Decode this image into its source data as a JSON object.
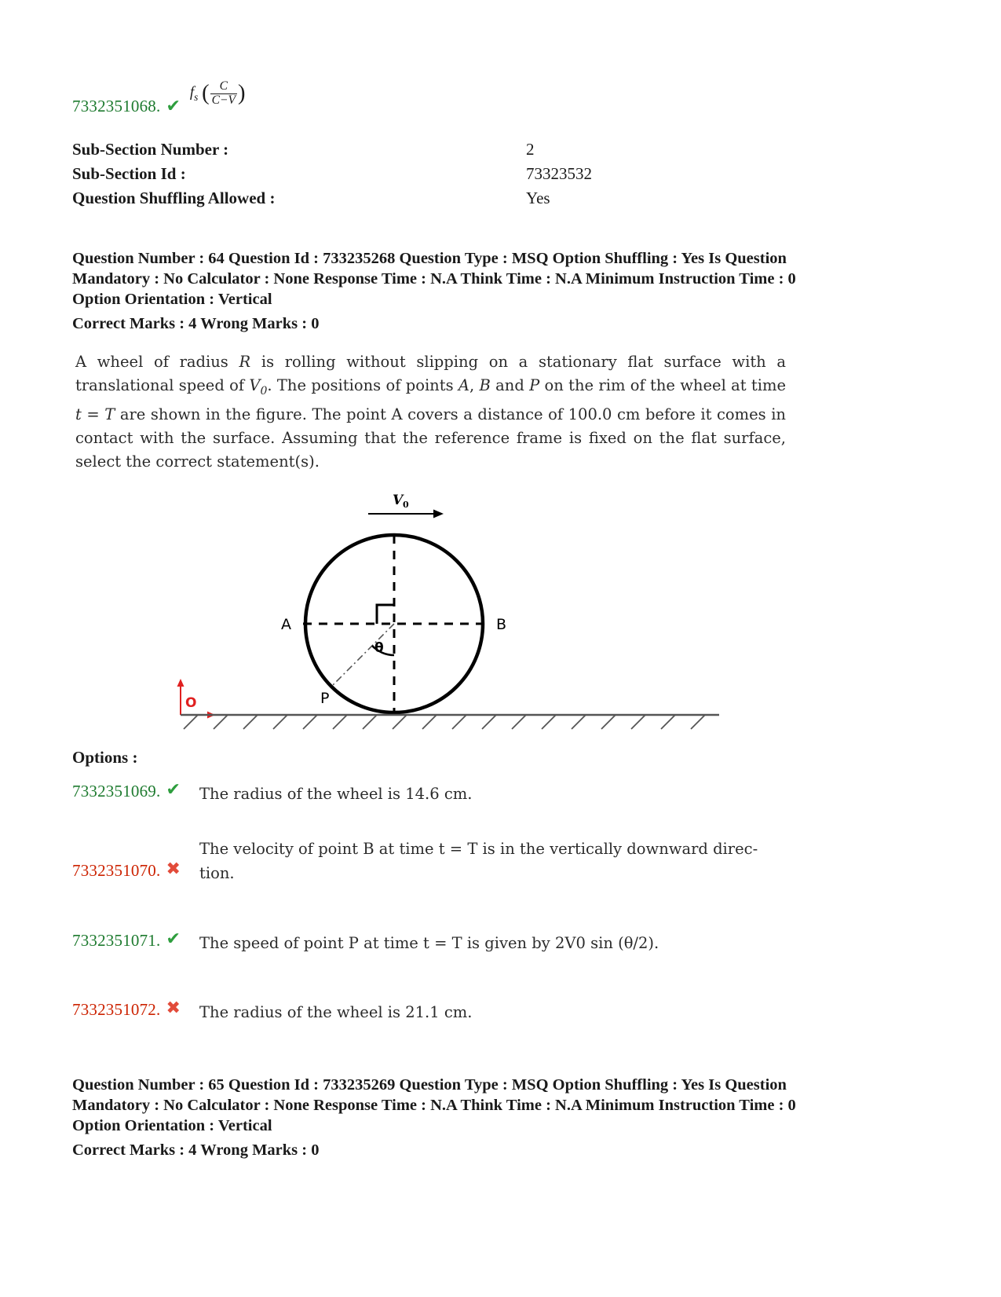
{
  "top_answer": {
    "option_id": "7332351068.",
    "status": "correct",
    "mark_glyph": "✔",
    "formula_fs": "f",
    "formula_sub": "s",
    "formula_num": "C",
    "formula_den": "C−V"
  },
  "meta": {
    "rows": [
      {
        "label": "Sub-Section Number :",
        "value": "2"
      },
      {
        "label": "Sub-Section Id :",
        "value": "73323532"
      },
      {
        "label": "Question Shuffling Allowed :",
        "value": "Yes"
      }
    ]
  },
  "question_64": {
    "header_line1": "Question Number : 64 Question Id : 733235268 Question Type : MSQ Option Shuffling : Yes Is",
    "header_line2": "Question Mandatory : No Calculator : None Response Time : N.A Think Time : N.A Minimum",
    "header_line3": "Instruction Time : 0 Option Orientation : Vertical",
    "marks": "Correct Marks : 4 Wrong Marks : 0",
    "body_part1": "A wheel of radius ",
    "body_R": "R",
    "body_part2": " is rolling without slipping on a stationary flat surface with a translational speed of ",
    "body_V": "V",
    "body_V_sub": "0",
    "body_part3": ". The positions of points ",
    "body_A": "A",
    "body_comma": ", ",
    "body_B": "B",
    "body_and": " and ",
    "body_P": "P",
    "body_part4": " on the rim of the wheel at time ",
    "body_t": "t",
    "body_eq": " = ",
    "body_T": "T",
    "body_part5": " are shown in the figure. The point A covers a distance of 100.0 cm before it comes in contact with the surface. Assuming that the reference frame is fixed on the flat surface, select the correct statement(s).",
    "options_label": "Options :",
    "options": [
      {
        "id": "7332351069.",
        "status": "correct",
        "mark_glyph": "✔",
        "text": "The radius of the wheel is 14.6 cm.",
        "wrapped": false
      },
      {
        "id": "7332351070.",
        "status": "wrong",
        "mark_glyph": "✖",
        "text_line1": "The velocity of point B at time t = T is in the vertically downward direc-",
        "text_line2": "tion.",
        "wrapped": true
      },
      {
        "id": "7332351071.",
        "status": "correct",
        "mark_glyph": "✔",
        "text": "The speed of point P at time t = T is given by 2V0 sin (θ/2).",
        "wrapped": false
      },
      {
        "id": "7332351072.",
        "status": "wrong",
        "mark_glyph": "✖",
        "text": "The radius of the wheel is 21.1 cm.",
        "wrapped": false
      }
    ]
  },
  "figure": {
    "velocity_label": "V",
    "velocity_sub": "0",
    "label_A": "A",
    "label_B": "B",
    "label_P": "P",
    "label_theta": "θ",
    "label_origin": "O",
    "origin_color": "#e02020",
    "ground_color": "#555555",
    "wheel_color": "#000000"
  },
  "question_65": {
    "header_line1": "Question Number : 65 Question Id : 733235269 Question Type : MSQ Option Shuffling : Yes Is",
    "header_line2": "Question Mandatory : No Calculator : None Response Time : N.A Think Time : N.A Minimum",
    "header_line3": "Instruction Time : 0 Option Orientation : Vertical",
    "marks": "Correct Marks : 4 Wrong Marks : 0"
  }
}
